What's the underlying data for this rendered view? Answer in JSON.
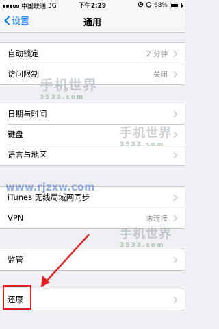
{
  "status": {
    "carrier": "中国联通",
    "network": "3G",
    "time": "下午2:29",
    "battery": "68%",
    "battery_level": 0.68
  },
  "nav": {
    "back_label": "设置",
    "title": "通用"
  },
  "groups": [
    {
      "rows": [
        {
          "label": "自动锁定",
          "value": "2 分钟"
        },
        {
          "label": "访问限制",
          "value": "关闭"
        }
      ]
    },
    {
      "rows": [
        {
          "label": "日期与时间",
          "value": ""
        },
        {
          "label": "键盘",
          "value": ""
        },
        {
          "label": "语言与地区",
          "value": ""
        }
      ]
    },
    {
      "rows": [
        {
          "label": "iTunes 无线局域网同步",
          "value": ""
        },
        {
          "label": "VPN",
          "value": "未连接"
        }
      ]
    },
    {
      "rows": [
        {
          "label": "监管",
          "value": ""
        }
      ]
    },
    {
      "rows": [
        {
          "label": "还原",
          "value": ""
        }
      ]
    }
  ],
  "watermarks": {
    "brand": "手机世界",
    "sub": "3533.com",
    "url": "www.rjzxw.com"
  },
  "colors": {
    "accent": "#007aff",
    "highlight": "#e02020"
  }
}
